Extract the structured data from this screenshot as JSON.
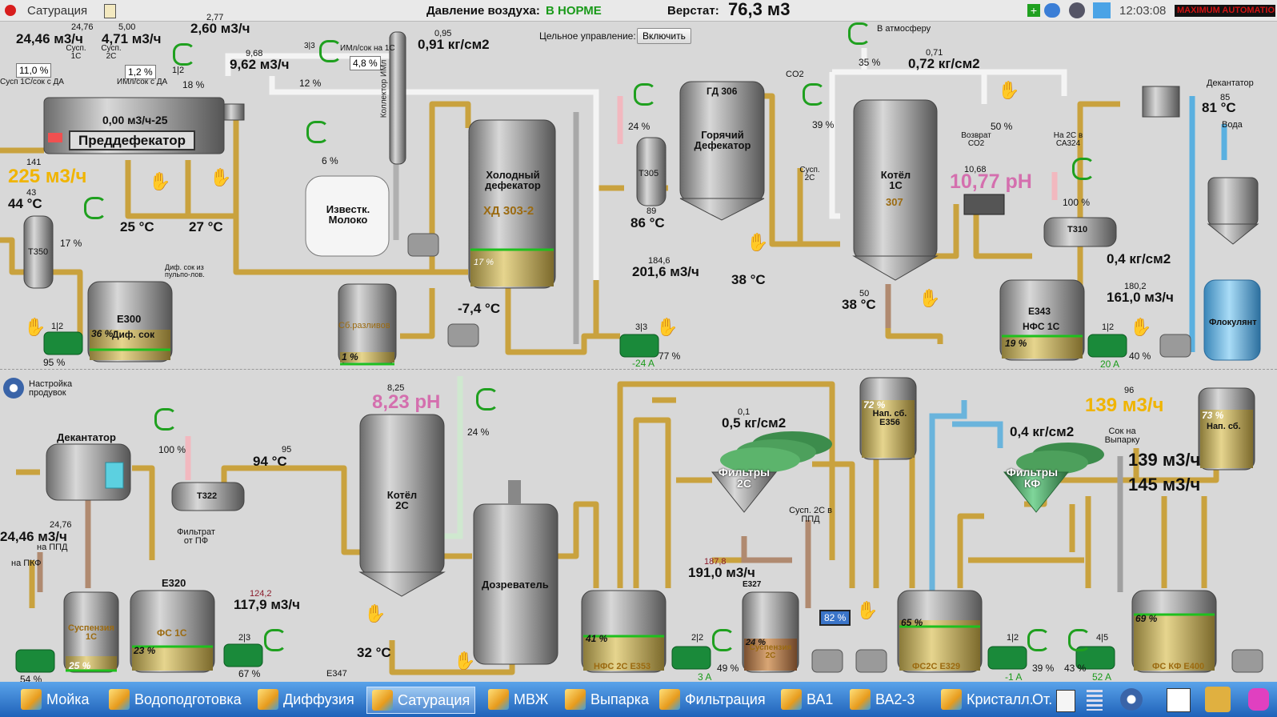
{
  "app": {
    "title": "Сатурация"
  },
  "header": {
    "air_label": "Давление воздуха:",
    "air_status": "В НОРМЕ",
    "verstat_label": "Верстат:",
    "verstat_value": "76,3 м3",
    "time": "12:03:08",
    "logo": "MAXIMUM AUTOMATION",
    "whole_control_label": "Цельное управление:",
    "enable_button": "Включить"
  },
  "top": {
    "flow_1c": "24,46 м3/ч",
    "flow_1c_sp": "24,76",
    "label_susp1c": "Сусп. 1С",
    "flow_2c": "4,71 м3/ч",
    "flow_2c_sp": "5,00",
    "label_susp2c": "Сусп. 2С",
    "flow_260_sp": "2,77",
    "flow_260": "2,60 м3/ч",
    "flow_962_sp": "9,68",
    "flow_962": "9,62 м3/ч",
    "v33": "3|3",
    "v_iml": "ИМл/сок на 1С",
    "pct_iml": "4,8 %",
    "pct_12": "12 %",
    "press_091_sp": "0,95",
    "press_091": "0,91 кг/см2",
    "kollektor": "Коллектор ИМл",
    "box_11": "11,0 %",
    "box_12": "1,2 %",
    "lbl_susp_da": "Сусп 1С/сок с ДА",
    "lbl_iml_da": "ИМл/сок с ДА",
    "v12_18": "1|2",
    "pct_18": "18 %",
    "predef_flow": "0,00 м3/ч-25",
    "predef_name": "Преддефекатор",
    "flow_225_sp": "141",
    "flow_225": "225 м3/ч",
    "temp_44_sp": "43",
    "temp_44": "44 °C",
    "t350": "Т350",
    "pct_17": "17 %",
    "temp_25": "25 °C",
    "temp_27": "27 °C",
    "pct_6": "6 %",
    "izvest": "Известк. Молоко",
    "holod_def": "Холодный дефекатор",
    "xd": "ХД 303-2",
    "pct_17b": "17 %",
    "temp_neg74": "-7,4 °C",
    "diff_sok": "Диф. сок из пульпо-лов.",
    "e300": "Е300",
    "e300_sub": "Диф. сок",
    "pct_36": "36 %",
    "v12_95": "1|2",
    "pct_95": "95 %",
    "sb_razliv": "Сб.разливов",
    "pct_1": "1 %",
    "pct_24a": "24 %",
    "t305": "Т305",
    "temp_86_sp": "89",
    "temp_86": "86 °C",
    "flow_2016_sp": "184,6",
    "flow_2016": "201,6 м3/ч",
    "v33b": "3|3",
    "amp_neg24": "-24 A",
    "pct_77": "77 %",
    "gd306": "ГД 306",
    "gor_def": "Горячий Дефекатор",
    "temp_38a": "38 °C",
    "v_atm": "В атмосферу",
    "pct_35": "35 %",
    "co2": "CO2",
    "press_072_sp": "0,71",
    "press_072": "0,72 кг/см2",
    "pct_39": "39 %",
    "susp2c": "Сусп. 2С",
    "kotel1c": "Котёл 1С",
    "kotel1c_num": "307",
    "ph_1077_sp": "10,68",
    "ph_1077": "10,77 pH",
    "vozvrat": "Возврат СО2",
    "pct_50": "50 %",
    "na2c": "На 2С в СА324",
    "temp_38b_sp": "50",
    "temp_38b": "38 °C",
    "pct_100a": "100 %",
    "t310": "Т310",
    "dekant_lbl": "Декантатор",
    "temp_81_sp": "85",
    "temp_81": "81 °C",
    "voda": "Вода",
    "press_04a": "0,4 кг/см2",
    "flow_161_sp": "180,2",
    "flow_161": "161,0 м3/ч",
    "e343": "Е343",
    "nfs1c": "НФС 1С",
    "pct_19": "19 %",
    "v12c": "1|2",
    "amp_20": "20 A",
    "pct_40": "40 %",
    "flokul": "Флокулянт"
  },
  "bottom": {
    "nastroika": "Настройка продувок",
    "dekant": "Декантатор",
    "pct_100b": "100 %",
    "flow_2446_sp": "24,76",
    "flow_2446": "24,46 м3/ч",
    "na_ppd": "на ППД",
    "na_pkf": "на ПКФ",
    "t322": "Т322",
    "temp_94_sp": "95",
    "temp_94": "94 °C",
    "filtrat": "Фильтрат от ПФ",
    "ph_823_sp": "8,25",
    "ph_823": "8,23 pH",
    "pct_24b": "24 %",
    "kotel2c": "Котёл 2С",
    "dozrev": "Дозреватель",
    "susp1c_tank": "Суспензия 1С",
    "pct_25": "25 %",
    "pct_54": "54 %",
    "e320": "Е320",
    "fs1c": "ФС 1С",
    "pct_23": "23 %",
    "v23": "2|3",
    "pct_67": "67 %",
    "flow_1179_sp": "124,2",
    "flow_1179": "117,9 м3/ч",
    "temp_32": "32 °C",
    "e347": "Е347",
    "press_05_sp": "0,1",
    "press_05": "0,5 кг/см2",
    "filtr2c": "Фильтры 2С",
    "nfs2c": "НФС 2С Е353",
    "pct_41": "41 %",
    "v22": "2|2",
    "amp_3": "3 A",
    "pct_49": "49 %",
    "flow_191_sp": "187,8",
    "flow_191": "191,0 м3/ч",
    "e327": "Е327",
    "susp2c_tank": "Суспензия 2С",
    "pct_24c": "24 %",
    "pct_82": "82 %",
    "susp2c_ppd": "Сусп. 2С в ППД",
    "nap_sb_e356": "Нап. сб. Е356",
    "pct_72": "72 %",
    "press_04b": "0,4 кг/см2",
    "filtr_kf": "Фильтры КФ",
    "fs2c": "ФС2С Е329",
    "pct_65": "65 %",
    "v12d": "1|2",
    "amp_neg1": "-1 A",
    "pct_39b": "39 %",
    "flow_139_sp": "96",
    "flow_139": "139 м3/ч",
    "sok_vyparku": "Сок на Выпарку",
    "flow_139b": "139 м3/ч",
    "flow_145": "145 м3/ч",
    "nap_sb": "Нап. сб.",
    "pct_73": "73 %",
    "v45": "4|5",
    "amp_52": "52 A",
    "pct_43": "43 %",
    "fskf": "ФС КФ Е400",
    "pct_69": "69 %"
  },
  "taskbar": {
    "items": [
      "Мойка",
      "Водоподготовка",
      "Диффузия",
      "Сатурация",
      "МВЖ",
      "Выпарка",
      "Фильтрация",
      "ВА1",
      "ВА2-3",
      "Кристалл.",
      "От."
    ]
  },
  "colors": {
    "pipe": "#e2be5c",
    "pipe_edge": "#a8852c",
    "steam": "#f3f3f3",
    "blue_pipe": "#6fb6e0",
    "status_green": "#1a9a1a",
    "ph_pink": "#d46fae",
    "flow_gold": "#f0b400"
  }
}
